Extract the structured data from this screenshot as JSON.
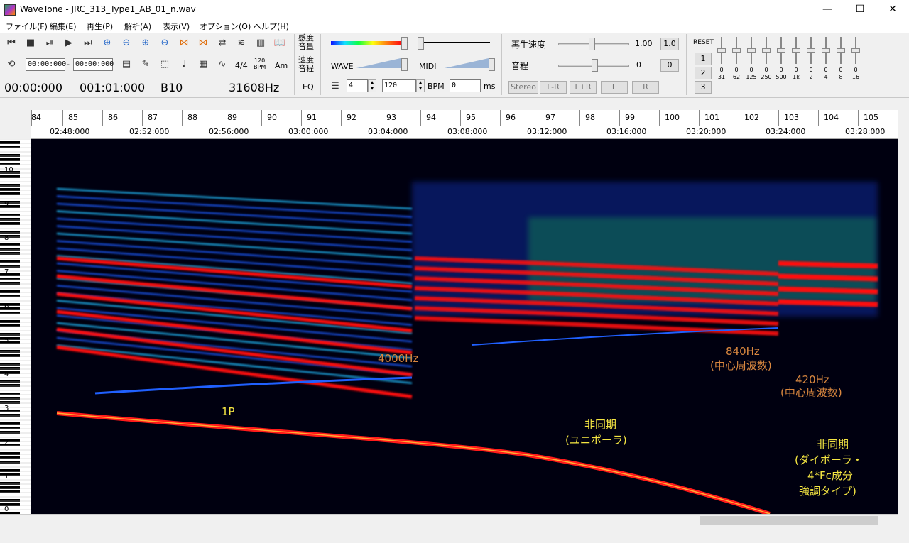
{
  "window": {
    "title": "WaveTone - JRC_313_Type1_AB_01_n.wav",
    "minimize": "—",
    "maximize": "☐",
    "close": "✕"
  },
  "menu": [
    "ファイル(F)",
    "編集(E)",
    "再生(P)",
    "解析(A)",
    "表示(V)",
    "オプション(O)",
    "ヘルプ(H)"
  ],
  "toolbar": {
    "time_start": "00:00:000",
    "time_end": "00:00:000",
    "time_sep": "-",
    "position": "00:00:000",
    "duration": "001:01:000",
    "note": "B10",
    "frequency": "31608Hz",
    "sensitivity_label": "感度\n音量",
    "speed_pitch_label": "速度\n音程",
    "eq_label": "EQ",
    "wave_label": "WAVE",
    "midi_label": "MIDI",
    "beat_value": "4",
    "bpm_value": "120",
    "bpm_label": "BPM",
    "ms_value": "0",
    "ms_label": "ms",
    "tempo_label": "4/4",
    "bpm_icon": "120\nBPM",
    "am_label": "Am",
    "playback_speed_label": "再生速度",
    "playback_speed_value": "1.00",
    "playback_speed_btn": "1.0",
    "pitch_label": "音程",
    "pitch_value": "0",
    "pitch_btn": "0",
    "stereo_buttons": [
      "Stereo",
      "L-R",
      "L+R",
      "L",
      "R"
    ],
    "reset_label": "RESET",
    "preset_buttons": [
      "1",
      "2",
      "3"
    ],
    "eq_values": [
      "0",
      "0",
      "0",
      "0",
      "0",
      "0",
      "0",
      "0",
      "0",
      "0"
    ],
    "eq_freqs": [
      "31",
      "62",
      "125",
      "250",
      "500",
      "1k",
      "2",
      "4",
      "8",
      "16"
    ]
  },
  "ruler": {
    "measures": [
      "84",
      "85",
      "86",
      "87",
      "88",
      "89",
      "90",
      "91",
      "92",
      "93",
      "94",
      "95",
      "96",
      "97",
      "98",
      "99",
      "100",
      "101",
      "102",
      "103",
      "104",
      "105"
    ],
    "times": [
      "02:48:000",
      "02:52:000",
      "02:56:000",
      "03:00:000",
      "03:04:000",
      "03:08:000",
      "03:12:000",
      "03:16:000",
      "03:20:000",
      "03:24:000",
      "03:28:000"
    ]
  },
  "piano": {
    "octaves": [
      "10",
      "9",
      "8",
      "7",
      "6",
      "5",
      "4",
      "3",
      "2",
      "1",
      "0"
    ]
  },
  "annotations": {
    "freq_4000": "4000Hz",
    "freq_840": "840Hz",
    "center_freq_1": "(中心周波数)",
    "freq_420": "420Hz",
    "center_freq_2": "(中心周波数)",
    "one_p": "1P",
    "async_uni_1": "非同期",
    "async_uni_2": "(ユニポーラ)",
    "async_di_1": "非同期",
    "async_di_2": "(ダイポーラ・",
    "async_di_3": "4*Fc成分",
    "async_di_4": "強調タイプ)"
  },
  "colors": {
    "annotation_yellow": "#f5e642",
    "annotation_orange": "#d9873f",
    "spectrum_red": "#ff1010",
    "spectrum_blue": "#1040ff"
  }
}
